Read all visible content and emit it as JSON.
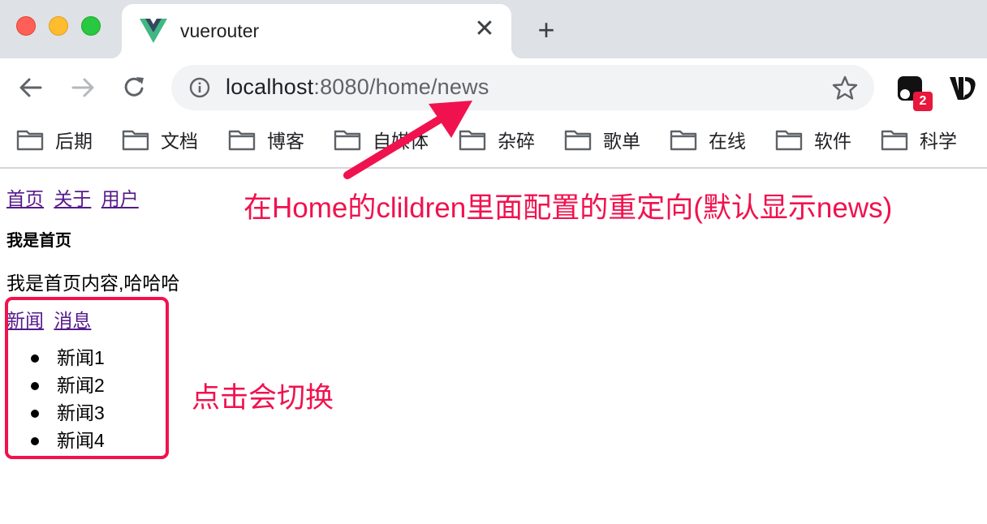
{
  "browser": {
    "tab": {
      "title": "vuerouter",
      "close_glyph": "✕",
      "favicon": "vue-logo-icon"
    },
    "new_tab_glyph": "+",
    "address_bar": {
      "host": "localhost",
      "rest": ":8080/home/news"
    },
    "extensions": {
      "badge_count": "2"
    },
    "bookmarks": [
      "后期",
      "文档",
      "博客",
      "自媒体",
      "杂碎",
      "歌单",
      "在线",
      "软件",
      "科学"
    ]
  },
  "page": {
    "top_nav": [
      "首页",
      "关于",
      "用户"
    ],
    "home_title": "我是首页",
    "home_content": "我是首页内容,哈哈哈",
    "sub_nav": [
      "新闻",
      "消息"
    ],
    "news_items": [
      "新闻1",
      "新闻2",
      "新闻3",
      "新闻4"
    ]
  },
  "annotations": {
    "redirect_note": "在Home的clildren里面配置的重定向(默认显示news)",
    "switch_note": "点击会切换",
    "color": "#f0124e"
  },
  "colors": {
    "tabstrip_bg": "#dee1e6",
    "omnibox_bg": "#f1f3f4",
    "link_visited": "#551a8b",
    "vue_green": "#41b883",
    "vue_dark": "#34495e"
  }
}
